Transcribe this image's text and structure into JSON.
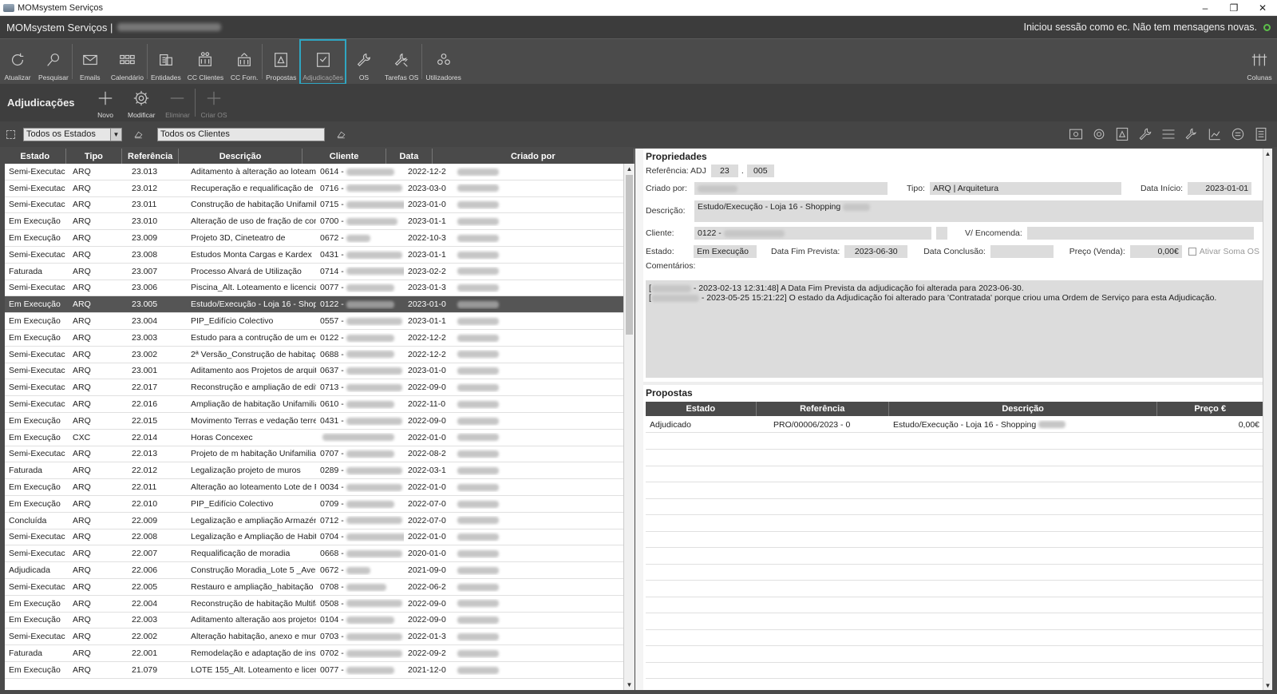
{
  "window": {
    "title": "MOMsystem Serviços",
    "minimize": "–",
    "maximize": "❐",
    "close": "✕"
  },
  "header": {
    "app": "MOMsystem Serviços |",
    "session": "Iniciou sessão como ec. Não tem mensagens novas."
  },
  "ribbon": {
    "atualizar": "Atualizar",
    "pesquisar": "Pesquisar",
    "emails": "Emails",
    "calendario": "Calendário",
    "entidades": "Entidades",
    "cc_clientes": "CC Clientes",
    "cc_forn": "CC Forn.",
    "propostas": "Propostas",
    "adjudicacoes": "Adjudicações",
    "os": "OS",
    "tarefas_os": "Tarefas OS",
    "utilizadores": "Utilizadores",
    "colunas": "Colunas"
  },
  "section": {
    "title": "Adjudicações",
    "novo": "Novo",
    "modificar": "Modificar",
    "eliminar": "Eliminar",
    "criar_os": "Criar OS"
  },
  "filters": {
    "estado": "Todos os Estados",
    "clientes": "Todos os Clientes"
  },
  "table": {
    "headers": [
      "Estado",
      "Tipo",
      "Referência",
      "Descrição",
      "Cliente",
      "Data",
      "Criado por"
    ],
    "rows": [
      {
        "estado": "Semi-Executac",
        "tipo": "ARQ",
        "ref": "23.013",
        "desc": "Aditamento à alteração ao loteame",
        "cli": "0614 -",
        "data": "2022-12-2"
      },
      {
        "estado": "Semi-Executac",
        "tipo": "ARQ",
        "ref": "23.012",
        "desc": "Recuperação e requalificação de h",
        "cli": "0716 -",
        "data": "2023-03-0"
      },
      {
        "estado": "Semi-Executac",
        "tipo": "ARQ",
        "ref": "23.011",
        "desc": "Construção de habitação Unifamil",
        "cli": "0715 -",
        "data": "2023-01-0"
      },
      {
        "estado": "Em Execução",
        "tipo": "ARQ",
        "ref": "23.010",
        "desc": "Alteração de uso de fração de com",
        "cli": "0700 -",
        "data": "2023-01-1"
      },
      {
        "estado": "Em Execução",
        "tipo": "ARQ",
        "ref": "23.009",
        "desc": "Projeto 3D, Cineteatro de",
        "cli": "0672 -",
        "data": "2022-10-3"
      },
      {
        "estado": "Semi-Executac",
        "tipo": "ARQ",
        "ref": "23.008",
        "desc": "Estudos Monta Cargas e Kardex",
        "cli": "0431 -",
        "data": "2023-01-1"
      },
      {
        "estado": "Faturada",
        "tipo": "ARQ",
        "ref": "23.007",
        "desc": "Processo Alvará de Utilização",
        "cli": "0714 -",
        "data": "2023-02-2"
      },
      {
        "estado": "Semi-Executac",
        "tipo": "ARQ",
        "ref": "23.006",
        "desc": "Piscina_Alt. Loteamento e licencia",
        "cli": "0077 -",
        "data": "2023-01-3"
      },
      {
        "estado": "Em Execução",
        "tipo": "ARQ",
        "ref": "23.005",
        "desc": "Estudo/Execução - Loja 16 - Shopp",
        "cli": "0122 -",
        "data": "2023-01-0"
      },
      {
        "estado": "Em Execução",
        "tipo": "ARQ",
        "ref": "23.004",
        "desc": "PIP_Edifício Colectivo",
        "cli": "0557 -",
        "data": "2023-01-1"
      },
      {
        "estado": "Em Execução",
        "tipo": "ARQ",
        "ref": "23.003",
        "desc": "Estudo para a contrução de um ed",
        "cli": "0122 -",
        "data": "2022-12-2"
      },
      {
        "estado": "Semi-Executac",
        "tipo": "ARQ",
        "ref": "23.002",
        "desc": "2ª Versão_Construção de habitaçã",
        "cli": "0688 -",
        "data": "2022-12-2"
      },
      {
        "estado": "Semi-Executac",
        "tipo": "ARQ",
        "ref": "23.001",
        "desc": "Aditamento aos Projetos de arquit",
        "cli": "0637 -",
        "data": "2023-01-0"
      },
      {
        "estado": "Semi-Executac",
        "tipo": "ARQ",
        "ref": "22.017",
        "desc": "Reconstrução e ampliação de edif",
        "cli": "0713 -",
        "data": "2022-09-0"
      },
      {
        "estado": "Semi-Executac",
        "tipo": "ARQ",
        "ref": "22.016",
        "desc": "Ampliação de habitação Unifamilia",
        "cli": "0610 -",
        "data": "2022-11-0"
      },
      {
        "estado": "Em Execução",
        "tipo": "ARQ",
        "ref": "22.015",
        "desc": "Movimento Terras e vedação terrer",
        "cli": "0431 -",
        "data": "2022-09-0"
      },
      {
        "estado": "Em Execução",
        "tipo": "CXC",
        "ref": "22.014",
        "desc": "Horas Concexec",
        "cli": "",
        "data": "2022-01-0"
      },
      {
        "estado": "Semi-Executac",
        "tipo": "ARQ",
        "ref": "22.013",
        "desc": "Projeto de m habitação Unifamiliar",
        "cli": "0707 -",
        "data": "2022-08-2"
      },
      {
        "estado": "Faturada",
        "tipo": "ARQ",
        "ref": "22.012",
        "desc": "Legalização projeto de muros",
        "cli": "0289 -",
        "data": "2022-03-1"
      },
      {
        "estado": "Em Execução",
        "tipo": "ARQ",
        "ref": "22.011",
        "desc": "Alteração ao loteamento Lote de P",
        "cli": "0034 -",
        "data": "2022-01-0"
      },
      {
        "estado": "Em Execução",
        "tipo": "ARQ",
        "ref": "22.010",
        "desc": "PIP_Edifício Colectivo",
        "cli": "0709 -",
        "data": "2022-07-0"
      },
      {
        "estado": "Concluída",
        "tipo": "ARQ",
        "ref": "22.009",
        "desc": "Legalização e ampliação Armazén",
        "cli": "0712 -",
        "data": "2022-07-0"
      },
      {
        "estado": "Semi-Executac",
        "tipo": "ARQ",
        "ref": "22.008",
        "desc": "Legalização e Ampliação de Habit",
        "cli": "0704 -",
        "data": "2022-01-0"
      },
      {
        "estado": "Semi-Executac",
        "tipo": "ARQ",
        "ref": "22.007",
        "desc": "Requalificação de moradia",
        "cli": "0668 -",
        "data": "2020-01-0"
      },
      {
        "estado": "Adjudicada",
        "tipo": "ARQ",
        "ref": "22.006",
        "desc": "Construção Moradia_Lote 5 _Aveir",
        "cli": "0672 -",
        "data": "2021-09-0"
      },
      {
        "estado": "Semi-Executac",
        "tipo": "ARQ",
        "ref": "22.005",
        "desc": "Restauro e ampliação_habitação",
        "cli": "0708 -",
        "data": "2022-06-2"
      },
      {
        "estado": "Em Execução",
        "tipo": "ARQ",
        "ref": "22.004",
        "desc": "Reconstrução de habitação Multifa",
        "cli": "0508 -",
        "data": "2022-09-0"
      },
      {
        "estado": "Em Execução",
        "tipo": "ARQ",
        "ref": "22.003",
        "desc": "Aditamento alteração aos projetos",
        "cli": "0104 -",
        "data": "2022-09-0"
      },
      {
        "estado": "Semi-Executac",
        "tipo": "ARQ",
        "ref": "22.002",
        "desc": "Alteração habitação, anexo e muro",
        "cli": "0703 -",
        "data": "2022-01-3"
      },
      {
        "estado": "Faturada",
        "tipo": "ARQ",
        "ref": "22.001",
        "desc": "Remodelação e adaptação de inst",
        "cli": "0702 -",
        "data": "2022-09-2"
      },
      {
        "estado": "Em Execução",
        "tipo": "ARQ",
        "ref": "21.079",
        "desc": "LOTE 155_Alt. Loteamento e licen",
        "cli": "0077 -",
        "data": "2021-12-0"
      }
    ]
  },
  "props": {
    "title": "Propriedades",
    "ref_label": "Referência: ADJ",
    "ref_year": "23",
    "ref_dot": ".",
    "ref_num": "005",
    "criado_label": "Criado por:",
    "tipo_label": "Tipo:",
    "tipo_value": "ARQ | Arquitetura",
    "inicio_label": "Data Início:",
    "inicio_value": "2023-01-01",
    "desc_label": "Descrição:",
    "desc_value": "Estudo/Execução - Loja 16 - Shopping",
    "cliente_label": "Cliente:",
    "cliente_value": "0122 -",
    "encomenda_label": "V/ Encomenda:",
    "estado_label": "Estado:",
    "estado_value": "Em Execução",
    "fim_label": "Data Fim Prevista:",
    "fim_value": "2023-06-30",
    "conclusao_label": "Data Conclusão:",
    "preco_label": "Preço (Venda):",
    "preco_value": "0,00€",
    "soma_label": "Ativar Soma OS",
    "comentarios_label": "Comentários:",
    "comment1": "- 2023-02-13 12:31:48] A Data Fim Prevista da adjudicação foi alterada para  2023-06-30.",
    "comment2": "- 2023-05-25 15:21:22] O estado da Adjudicação foi alterado para 'Contratada' porque criou uma Ordem de Serviço para esta Adjudicação."
  },
  "propostas": {
    "title": "Propostas",
    "headers": [
      "Estado",
      "Referência",
      "Descrição",
      "Preço €"
    ],
    "row": {
      "estado": "Adjudicado",
      "ref": "PRO/00006/2023 - 0",
      "desc": "Estudo/Execução - Loja 16 - Shopping",
      "preco": "0,00€"
    }
  },
  "icons": {
    "colors": {
      "accent": "#2fa6c2",
      "status_ok": "#5cc04a"
    }
  }
}
